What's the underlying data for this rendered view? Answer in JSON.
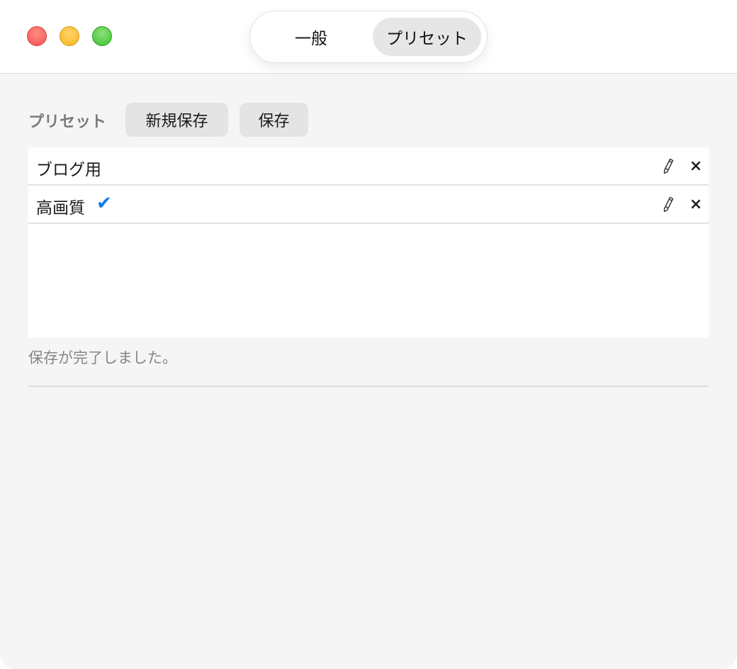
{
  "window": {
    "tabs": [
      {
        "label": "一般",
        "selected": false
      },
      {
        "label": "プリセット",
        "selected": true
      }
    ]
  },
  "presets": {
    "section_label": "プリセット",
    "new_save_label": "新規保存",
    "save_label": "保存",
    "items": [
      {
        "name": "ブログ用",
        "active": false
      },
      {
        "name": "高画質",
        "active": true
      }
    ],
    "check_glyph": "✔",
    "delete_glyph": "×"
  },
  "status": {
    "message": "保存が完了しました。"
  },
  "colors": {
    "accent_check": "#1479e8",
    "traffic_close": "#f2554e",
    "traffic_minimize": "#f7b21f",
    "traffic_zoom": "#3dbf2e"
  }
}
